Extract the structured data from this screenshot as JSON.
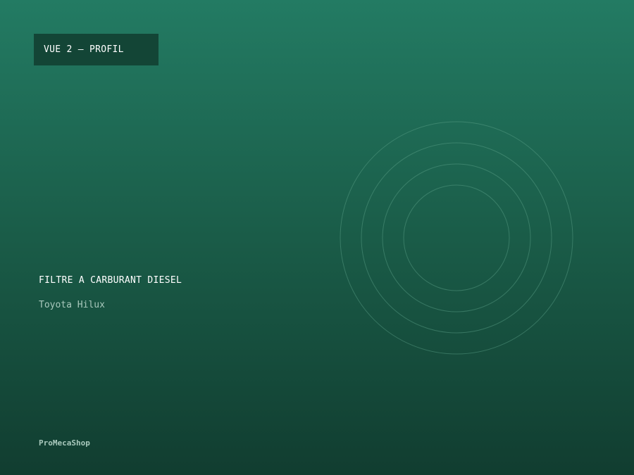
{
  "badge": {
    "label": "VUE 2 — PROFIL"
  },
  "product": {
    "title": "FILTRE A CARBURANT DIESEL",
    "vehicle": "Toyota Hilux"
  },
  "brand": {
    "name": "ProMecaShop"
  },
  "colors": {
    "background_top": "#237b63",
    "background_bottom": "#113d30",
    "badge_background": "#134536",
    "ring_stroke": "#5fa58c"
  },
  "illustration": {
    "icon": "concentric-rings-icon",
    "ring_count": 4
  }
}
